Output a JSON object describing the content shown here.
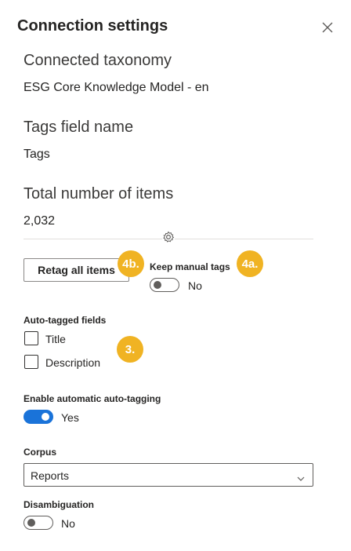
{
  "panel": {
    "title": "Connection settings",
    "close_icon": "close-icon"
  },
  "connected_taxonomy": {
    "label": "Connected taxonomy",
    "value": "ESG Core Knowledge Model - en"
  },
  "tags_field": {
    "label": "Tags field name",
    "value": "Tags"
  },
  "total_items": {
    "label": "Total number of items",
    "value": "2,032"
  },
  "divider_icon": "gear-icon",
  "retag": {
    "button_label": "Retag all items",
    "badge": "4b."
  },
  "keep_manual_tags": {
    "label": "Keep manual tags",
    "state": "No",
    "checked": false,
    "badge": "4a."
  },
  "auto_tagged_fields": {
    "label": "Auto-tagged fields",
    "badge": "3.",
    "options": [
      {
        "label": "Title",
        "checked": false
      },
      {
        "label": "Description",
        "checked": false
      }
    ]
  },
  "enable_auto_tagging": {
    "label": "Enable automatic auto-tagging",
    "state": "Yes",
    "checked": true
  },
  "corpus": {
    "label": "Corpus",
    "selected": "Reports",
    "icon": "chevron-down-icon"
  },
  "disambiguation": {
    "label": "Disambiguation",
    "state": "No",
    "checked": false
  },
  "colors": {
    "accent": "#1a73d9",
    "badge": "#f0b323",
    "text": "#252423",
    "divider": "#e1dfdd"
  }
}
